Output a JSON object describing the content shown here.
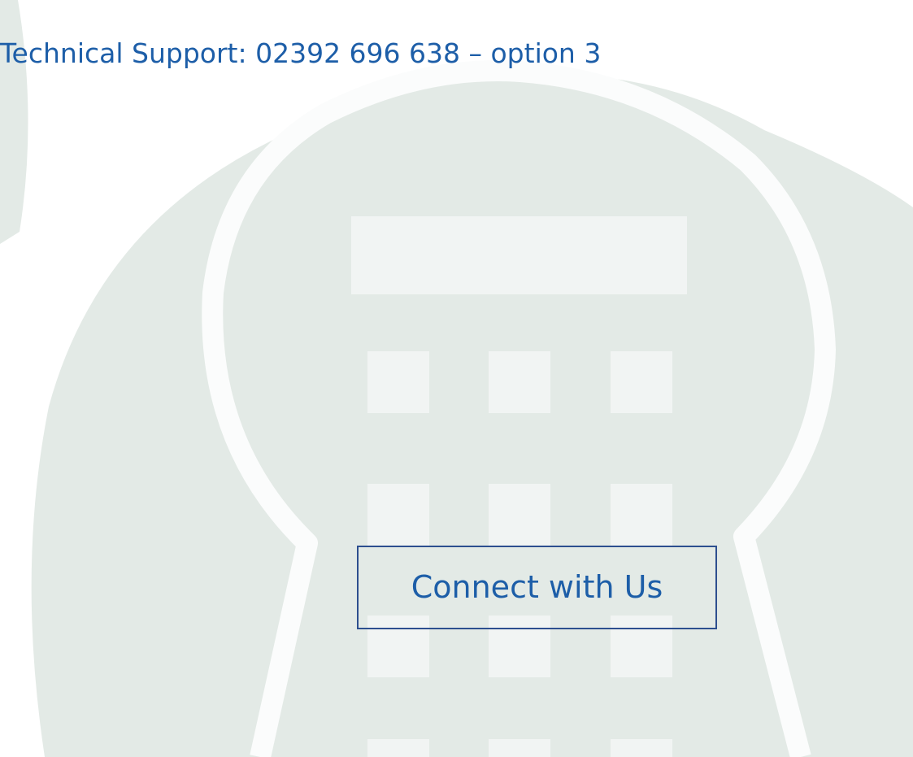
{
  "colors": {
    "background": "#ffffff",
    "watermark_shape": "#e3eae6",
    "watermark_cutout": "#f1f4f3",
    "ring_outline": "#fbfcfc",
    "text_blue": "#1d5ea8",
    "button_border": "#2d4f8f"
  },
  "support": {
    "text": "Technical Support: 02392 696 638 – option 3"
  },
  "connect": {
    "label": "Connect with Us"
  },
  "watermark": {
    "icon": "calculator-icon"
  }
}
